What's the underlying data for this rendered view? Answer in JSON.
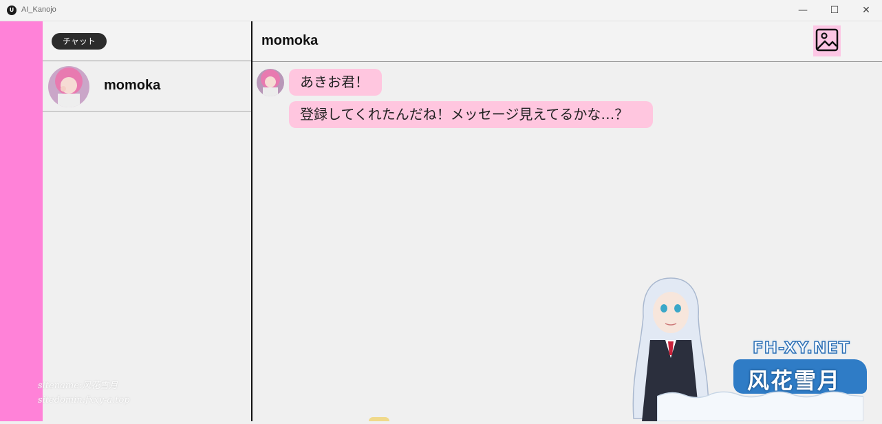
{
  "window": {
    "title": "AI_Kanojo",
    "app_icon_glyph": "U",
    "minimize_glyph": "—",
    "maximize_glyph": "☐",
    "close_glyph": "✕"
  },
  "sidebar": {
    "tab_label": "チャット",
    "contacts": [
      {
        "name": "momoka"
      }
    ]
  },
  "chat": {
    "title": "momoka",
    "image_button_icon": "image-icon",
    "messages": [
      {
        "sender": "momoka",
        "text": "あきお君！"
      },
      {
        "sender": "momoka",
        "text": "登録してくれたんだね！メッセージ見えてるかな…？"
      }
    ]
  },
  "watermarks": {
    "line1": "sitename:风花雪月",
    "line2": "sitedomin:fxxy-a.top",
    "site": "FH-XY.NET",
    "banner": "风花雪月"
  },
  "colors": {
    "accent_pink": "#ff82d8",
    "bubble_pink": "#ffc6df",
    "button_pink": "#fcc6e4",
    "pill_dark": "#2c2c2c"
  }
}
